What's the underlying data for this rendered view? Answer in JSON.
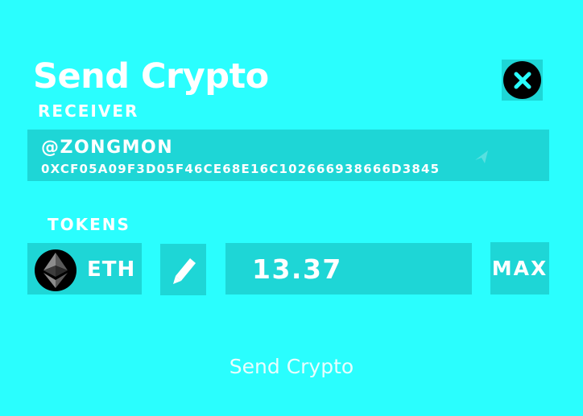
{
  "header": {
    "title": "Send Crypto",
    "close_icon": "close-x-icon"
  },
  "receiver": {
    "label": "RECEIVER",
    "name": "@ZONGMON",
    "address": "0XCF05A09F3D05F46CE68E16C102666938666D3845",
    "copy_icon": "copy-icon"
  },
  "tokens": {
    "label": "TOKENS",
    "selected_symbol": "ETH",
    "logo_icon": "ethereum-icon",
    "edit_icon": "pencil-icon",
    "amount": "13.37",
    "max_label": "MAX"
  },
  "footer": {
    "send_label": "Send Crypto"
  },
  "colors": {
    "background": "#2afefe",
    "panel": "#1ed6d6",
    "text": "#ffffff"
  }
}
